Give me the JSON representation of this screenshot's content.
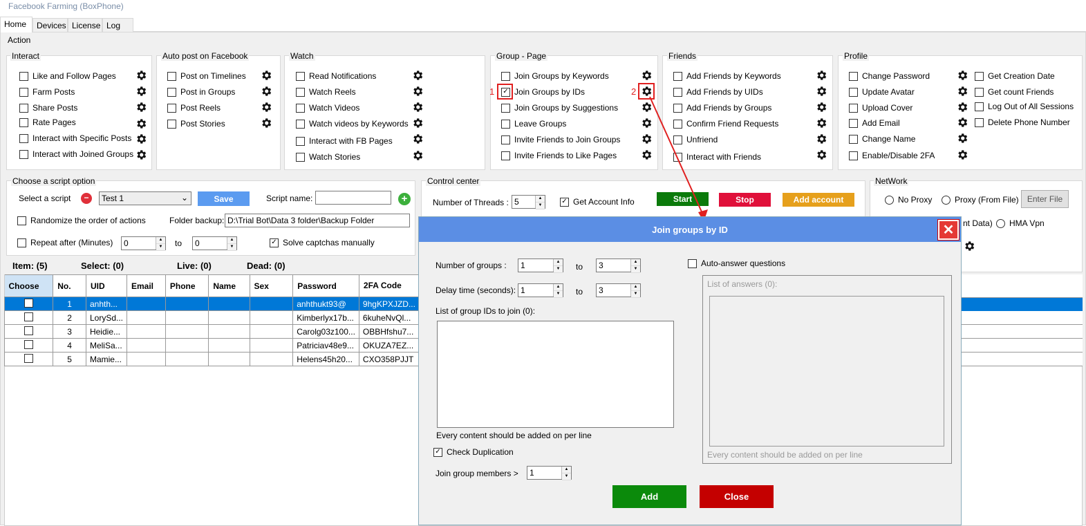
{
  "window": {
    "title": "Facebook Farming (BoxPhone)"
  },
  "tabs": [
    "Home",
    "Devices",
    "License",
    "Log"
  ],
  "action": {
    "label": "Action"
  },
  "interact": {
    "title": "Interact",
    "items": [
      "Like and Follow Pages",
      "Farm Posts",
      "Share Posts",
      "Rate Pages",
      "Interact with Specific Posts",
      "Interact with Joined Groups"
    ]
  },
  "autopost": {
    "title": "Auto post on Facebook",
    "items": [
      "Post on Timelines",
      "Post in Groups",
      "Post Reels",
      "Post Stories"
    ]
  },
  "watch": {
    "title": "Watch",
    "items": [
      "Read Notifications",
      "Watch Reels",
      "Watch Videos",
      "Watch videos by Keywords",
      "Interact with FB Pages",
      "Watch Stories"
    ]
  },
  "group": {
    "title": "Group - Page",
    "items": [
      "Join Groups by Keywords",
      "Join Groups by IDs",
      "Join Groups by Suggestions",
      "Leave Groups",
      "Invite Friends to Join Groups",
      "Invite Friends to Like Pages"
    ]
  },
  "friends": {
    "title": "Friends",
    "items": [
      "Add Friends by Keywords",
      "Add Friends by UIDs",
      "Add Friends by  Groups",
      "Confirm Friend Requests",
      "Unfriend",
      "Interact with Friends"
    ]
  },
  "profile": {
    "title": "Profile",
    "items": [
      "Change Password",
      "Update Avatar",
      "Upload Cover",
      "Add Email",
      "Change Name",
      "Enable/Disable 2FA"
    ],
    "items2": [
      "Get Creation Date",
      "Get count Friends",
      "Log Out of All Sessions",
      "Delete Phone Number"
    ]
  },
  "annotations": {
    "one": "1",
    "two": "2"
  },
  "script": {
    "title": "Choose a script option",
    "select_label": "Select a script",
    "select_value": "Test 1",
    "save": "Save",
    "name_label": "Script name:",
    "name_value": "",
    "randomize": "Randomize the order of actions",
    "folder_label": "Folder backup:",
    "folder_value": "D:\\Trial Bot\\Data 3 folder\\Backup Folder",
    "repeat": "Repeat after (Minutes)",
    "repeat_from": "0",
    "to": "to",
    "repeat_to": "0",
    "captcha": "Solve captchas manually"
  },
  "stats": {
    "item": "Item: (5)",
    "select": "Select: (0)",
    "live": "Live: (0)",
    "dead": "Dead: (0)"
  },
  "control": {
    "title": "Control center",
    "threads_label": "Number of Threads :",
    "threads": "5",
    "getinfo": "Get Account Info",
    "start": "Start",
    "stop": "Stop",
    "add": "Add account"
  },
  "network": {
    "title": "NetWork",
    "noproxy": "No Proxy",
    "proxy": "Proxy (From File)",
    "enter": "Enter File",
    "partial": "nt Data)",
    "hma": "HMA Vpn"
  },
  "table": {
    "headers": [
      "Choose",
      "No.",
      "UID",
      "Email",
      "Phone",
      "Name",
      "Sex",
      "Password",
      "2FA Code"
    ],
    "rows": [
      [
        "",
        "1",
        "anhth...",
        "",
        "",
        "",
        "",
        "anhthukt93@",
        "9hgKPXJZD..."
      ],
      [
        "",
        "2",
        "LorySd...",
        "",
        "",
        "",
        "",
        "Kimberlyx17b...",
        "6kuheNvQl..."
      ],
      [
        "",
        "3",
        "Heidie...",
        "",
        "",
        "",
        "",
        "Carolg03z100...",
        "OBBHfshu7..."
      ],
      [
        "",
        "4",
        "MeliSa...",
        "",
        "",
        "",
        "",
        "Patriciav48e9...",
        "OKUZA7EZ..."
      ],
      [
        "",
        "5",
        "Mamie...",
        "",
        "",
        "",
        "",
        "Helens45h20...",
        "CXO358PJJT"
      ]
    ]
  },
  "dialog": {
    "title": "Join groups by ID",
    "num_label": "Number of groups :",
    "num_from": "1",
    "num_to": "3",
    "to": "to",
    "delay_label": "Delay time (seconds):",
    "delay_from": "1",
    "delay_to": "3",
    "list_label": "List of group IDs to join (0):",
    "list_hint": "Every content should be added on per line",
    "check_dup": "Check Duplication",
    "members_label": "Join group members   >",
    "members": "1",
    "auto_answer": "Auto-answer questions",
    "answers_label": "List of answers (0):",
    "answers_hint": "Every content should be added on per line",
    "add": "Add",
    "close": "Close"
  },
  "colors": {
    "start": "#0b7a0b",
    "stop": "#e0103a",
    "add": "#e6a01c",
    "save": "#5b9bf0",
    "dialog_title": "#5b8ee4",
    "add_btn": "#0b8a0b",
    "close_btn": "#c40000"
  }
}
